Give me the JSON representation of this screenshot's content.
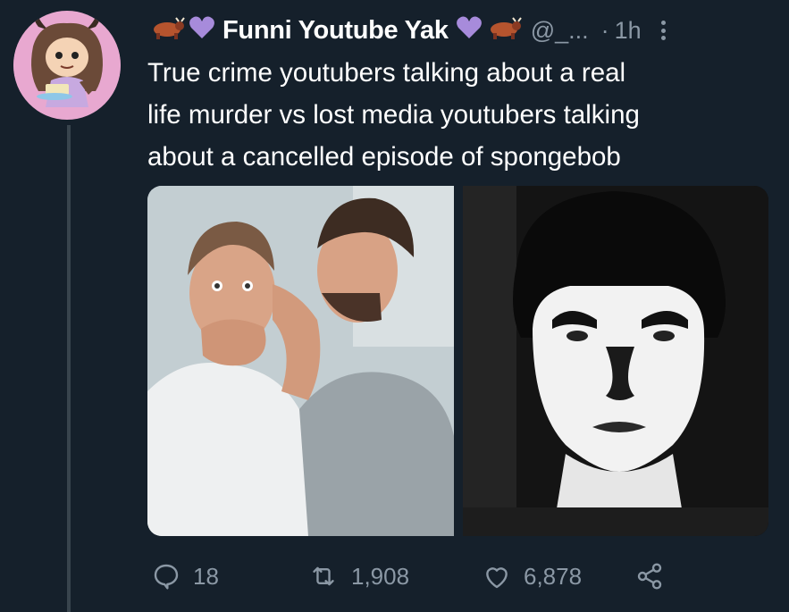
{
  "tweet": {
    "author_name": "Funni Youtube Yak",
    "handle": "@_...",
    "separator": "·",
    "time": "1h",
    "text": "True crime youtubers talking about a real\nlife murder vs lost media youtubers talking\nabout a cancelled episode of spongebob",
    "media": [
      {
        "label": "two men gossiping, one whispering, one covering mouth in shock"
      },
      {
        "label": "dark, high-contrast photo of a face lit from below"
      }
    ],
    "stats": {
      "replies": "18",
      "retweets": "1,908",
      "likes": "6,878"
    }
  },
  "icons": {
    "reply": "reply-icon",
    "retweet": "retweet-icon",
    "like": "heart-icon",
    "share": "share-icon",
    "more": "more-icon"
  },
  "colors": {
    "background": "#15202b",
    "muted": "#8b98a5",
    "heart_emoji": "#a78bdb",
    "yak_emoji": "#b5542e"
  }
}
